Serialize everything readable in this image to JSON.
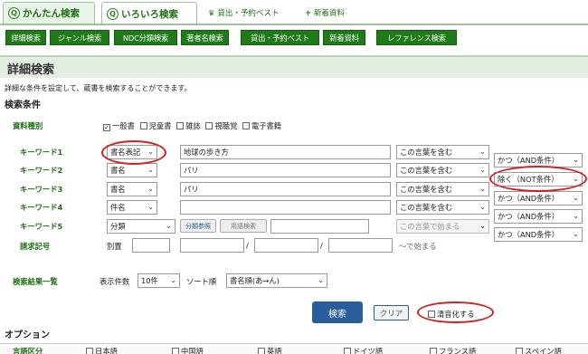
{
  "tabs": [
    {
      "label": "かんたん検索",
      "icon": "search-icon"
    },
    {
      "label": "いろいろ検索",
      "icon": "search-icon"
    }
  ],
  "toplinks": [
    {
      "label": "貸出・予約ベスト",
      "icon": "trophy-icon"
    },
    {
      "label": "新着資料",
      "icon": "new-plus-icon"
    }
  ],
  "subnav": [
    "詳細検索",
    "ジャンル検索",
    "NDC分類検索",
    "著者名検索",
    "貸出・予約ベスト",
    "新着資料",
    "レファレンス検索"
  ],
  "page_title": "詳細検索",
  "description": "詳細な条件を設定して、蔵書を検索することができます。",
  "section_conditions": "検索条件",
  "material": {
    "label": "資料種別",
    "options": [
      {
        "label": "一般書",
        "checked": true
      },
      {
        "label": "児童書",
        "checked": false
      },
      {
        "label": "雑誌",
        "checked": false
      },
      {
        "label": "視聴覚",
        "checked": false
      },
      {
        "label": "電子書籍",
        "checked": false
      }
    ]
  },
  "keywords": [
    {
      "label": "キーワード1",
      "field": "書名表記",
      "value": "地球の歩き方",
      "match": "この言葉を含む",
      "logic": "かつ（AND条件）"
    },
    {
      "label": "キーワード2",
      "field": "書名",
      "value": "パリ",
      "match": "この言葉を含む",
      "logic": "除く（NOT条件）"
    },
    {
      "label": "キーワード3",
      "field": "書名",
      "value": "パリ",
      "match": "この言葉を含む",
      "logic": "かつ（AND条件）"
    },
    {
      "label": "キーワード4",
      "field": "件名",
      "value": "",
      "match": "この言葉を含む",
      "logic": "かつ（AND条件）"
    },
    {
      "label": "キーワード5",
      "field": "分類",
      "value": "",
      "match": "この言葉で始まる",
      "logic": "かつ（AND条件）"
    }
  ],
  "kw5_buttons": [
    "分類参照",
    "用語検索"
  ],
  "callno": {
    "label": "請求記号",
    "sub": "別置",
    "slash": "/",
    "suffix": "～で始まる"
  },
  "results": {
    "label": "検索結果一覧",
    "count_label": "表示件数",
    "count_value": "10件",
    "sort_label": "ソート順",
    "sort_value": "書名順(あ→ん)"
  },
  "actions": {
    "search": "検索",
    "clear": "クリア",
    "voiced": "清音化する"
  },
  "options_title": "オプション",
  "language": {
    "label": "言語区分",
    "options": [
      "日本語",
      "中国語",
      "英語",
      "ドイツ語",
      "フランス語",
      "スペイン語"
    ]
  },
  "colors": {
    "green": "#1f7a18",
    "annotation": "#d42020",
    "search_btn": "#2a5d9c"
  }
}
